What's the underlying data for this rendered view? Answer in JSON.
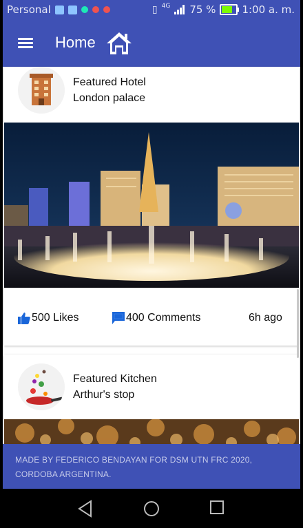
{
  "status_bar": {
    "carrier": "Personal",
    "network": "4G",
    "battery_percent": "75 %",
    "battery_level": 0.75,
    "time": "1:00 a. m.",
    "colors": {
      "bar": "#3F51B5",
      "battery_fill": "#7CFC00"
    }
  },
  "app_bar": {
    "title": "Home",
    "menu_icon": "menu-icon",
    "home_icon": "home-icon"
  },
  "cards": [
    {
      "category": "Featured Hotel",
      "name": "London palace",
      "likes_label": "500 Likes",
      "comments_label": "400 Comments",
      "time_ago": "6h ago",
      "image": "las-vegas-night-fountain"
    },
    {
      "category": "Featured Kitchen",
      "name": "Arthur's stop",
      "image": "autumn-trees"
    }
  ],
  "footer": {
    "line1": "MADE BY FEDERICO BENDAYAN FOR DSM UTN FRC 2020,",
    "line2": "CORDOBA ARGENTINA."
  },
  "nav": {
    "back": "back-icon",
    "home": "home-circle-icon",
    "recents": "recents-icon"
  },
  "colors": {
    "primary": "#3F51B5",
    "like_blue": "#1a66d9"
  }
}
